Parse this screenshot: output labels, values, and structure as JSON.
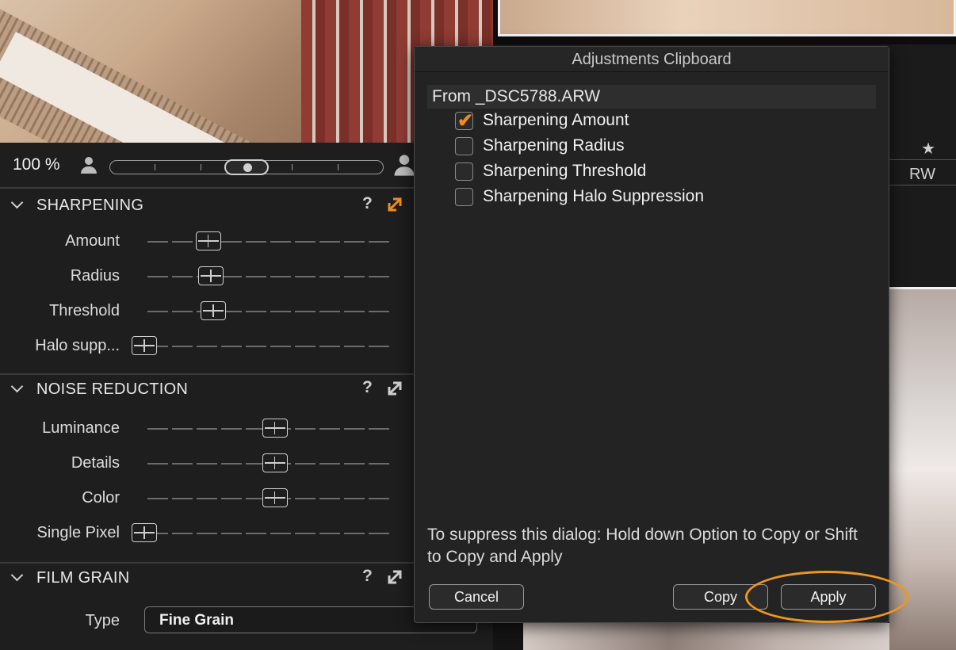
{
  "zoom": {
    "label": "100 %"
  },
  "right_strip": {
    "star": "★",
    "filename_suffix": "RW"
  },
  "sections": {
    "sharpening": {
      "title": "SHARPENING",
      "help": "?",
      "sliders": [
        {
          "label": "Amount",
          "value": 0.24
        },
        {
          "label": "Radius",
          "value": 0.25
        },
        {
          "label": "Threshold",
          "value": 0.26
        },
        {
          "label": "Halo supp...",
          "value": 0.0
        }
      ]
    },
    "noise_reduction": {
      "title": "NOISE REDUCTION",
      "help": "?",
      "sliders": [
        {
          "label": "Luminance",
          "value": 0.49
        },
        {
          "label": "Details",
          "value": 0.49
        },
        {
          "label": "Color",
          "value": 0.49
        },
        {
          "label": "Single Pixel",
          "value": 0.0
        }
      ]
    },
    "film_grain": {
      "title": "FILM GRAIN",
      "help": "?",
      "type_label": "Type",
      "type_value": "Fine Grain"
    }
  },
  "dialog": {
    "title": "Adjustments Clipboard",
    "from_label": "From _DSC5788.ARW",
    "items": [
      {
        "label": "Sharpening Amount",
        "checked": true
      },
      {
        "label": "Sharpening Radius",
        "checked": false
      },
      {
        "label": "Sharpening Threshold",
        "checked": false
      },
      {
        "label": "Sharpening Halo Suppression",
        "checked": false
      }
    ],
    "hint": "To suppress this dialog: Hold down Option to Copy or Shift to Copy and Apply",
    "buttons": {
      "cancel": "Cancel",
      "copy": "Copy",
      "apply": "Apply"
    }
  },
  "colors": {
    "accent": "#f08c1b",
    "highlight_ring": "#f0961e"
  }
}
